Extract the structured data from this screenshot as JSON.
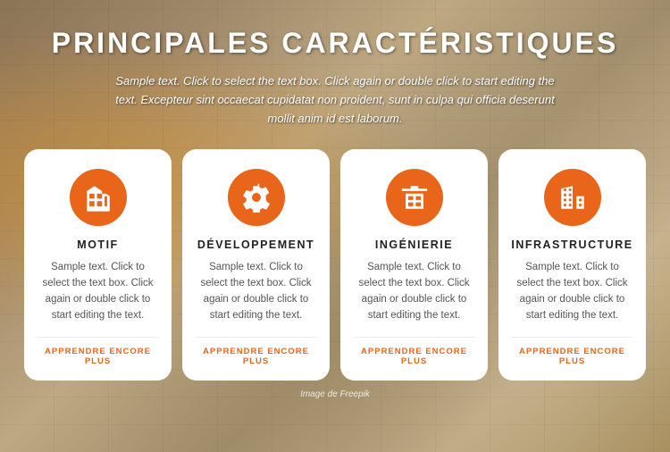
{
  "header": {
    "title": "PRINCIPALES CARACTÉRISTIQUES",
    "subtitle": "Sample text. Click to select the text box. Click again or double click to start editing the text. Excepteur sint occaecat cupidatat non proident, sunt in culpa qui officia deserunt mollit anim id est laborum."
  },
  "cards": [
    {
      "id": "motif",
      "icon": "building",
      "title": "MOTIF",
      "text": "Sample text. Click to select the text box. Click again or double click to start editing the text.",
      "link": "APPRENDRE ENCORE PLUS"
    },
    {
      "id": "developpement",
      "icon": "gear-building",
      "title": "DÉVELOPPEMENT",
      "text": "Sample text. Click to select the text box. Click again or double click to start editing the text.",
      "link": "APPRENDRE ENCORE PLUS"
    },
    {
      "id": "ingenierie",
      "icon": "crane-building",
      "title": "INGÉNIERIE",
      "text": "Sample text. Click to select the text box. Click again or double click to start editing the text.",
      "link": "APPRENDRE ENCORE PLUS"
    },
    {
      "id": "infrastructure",
      "icon": "city-building",
      "title": "INFRASTRUCTURE",
      "text": "Sample text. Click to select the text box. Click again or double click to start editing the text.",
      "link": "APPRENDRE ENCORE PLUS"
    }
  ],
  "footer": {
    "credit": "Image de Freepik"
  }
}
